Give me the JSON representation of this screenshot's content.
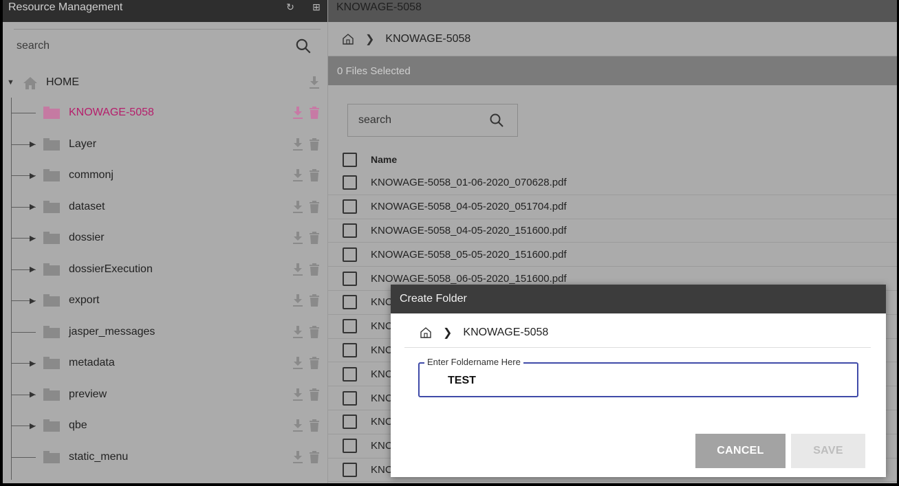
{
  "left_panel": {
    "title": "Resource Management",
    "search_placeholder": "search",
    "root_label": "HOME",
    "tree": [
      {
        "label": "KNOWAGE-5058",
        "selected": true,
        "expandable": false
      },
      {
        "label": "Layer",
        "selected": false,
        "expandable": true
      },
      {
        "label": "commonj",
        "selected": false,
        "expandable": true
      },
      {
        "label": "dataset",
        "selected": false,
        "expandable": true
      },
      {
        "label": "dossier",
        "selected": false,
        "expandable": true
      },
      {
        "label": "dossierExecution",
        "selected": false,
        "expandable": true
      },
      {
        "label": "export",
        "selected": false,
        "expandable": true
      },
      {
        "label": "jasper_messages",
        "selected": false,
        "expandable": false
      },
      {
        "label": "metadata",
        "selected": false,
        "expandable": true
      },
      {
        "label": "preview",
        "selected": false,
        "expandable": true
      },
      {
        "label": "qbe",
        "selected": false,
        "expandable": true
      },
      {
        "label": "static_menu",
        "selected": false,
        "expandable": false
      }
    ]
  },
  "right_panel": {
    "title": "KNOWAGE-5058",
    "breadcrumb": "KNOWAGE-5058",
    "selection_status": "0 Files Selected",
    "search_placeholder": "search",
    "column_name": "Name",
    "files": [
      "KNOWAGE-5058_01-06-2020_070628.pdf",
      "KNOWAGE-5058_04-05-2020_051704.pdf",
      "KNOWAGE-5058_04-05-2020_151600.pdf",
      "KNOWAGE-5058_05-05-2020_151600.pdf",
      "KNOWAGE-5058_06-05-2020_151600.pdf",
      "KNC",
      "KNC",
      "KNC",
      "KNC",
      "KNC",
      "KNC",
      "KNC",
      "KNC"
    ]
  },
  "dialog": {
    "title": "Create Folder",
    "breadcrumb": "KNOWAGE-5058",
    "field_label": "Enter Foldername Here",
    "field_value": "TEST",
    "cancel_label": "CANCEL",
    "save_label": "SAVE"
  },
  "colors": {
    "accent": "#3f4aa8",
    "selected_folder": "#b51e6b"
  }
}
